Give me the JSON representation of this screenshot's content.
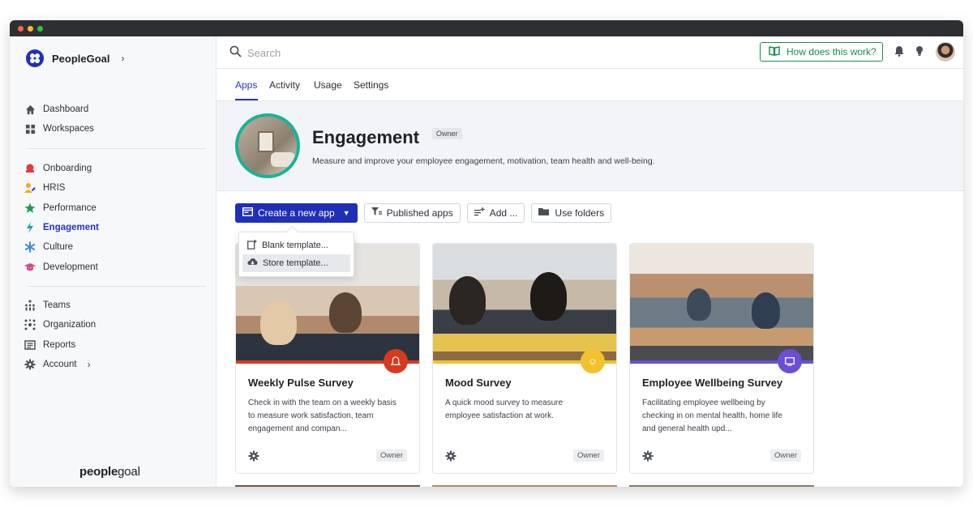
{
  "app": {
    "name": "PeopleGoal",
    "footer_brand_bold": "people",
    "footer_brand_light": "goal"
  },
  "sidebar": {
    "items_top": [
      {
        "label": "Dashboard",
        "icon": "home-icon"
      },
      {
        "label": "Workspaces",
        "icon": "grid-icon"
      }
    ],
    "items_modules": [
      {
        "label": "Onboarding",
        "icon": "onboarding-icon",
        "color": "#e23b3b"
      },
      {
        "label": "HRIS",
        "icon": "hris-icon",
        "color": "#f2a71b"
      },
      {
        "label": "Performance",
        "icon": "star-icon",
        "color": "#1f9d55"
      },
      {
        "label": "Engagement",
        "icon": "lightning-icon",
        "color": "#1aa39a"
      },
      {
        "label": "Culture",
        "icon": "asterisk-icon",
        "color": "#3a8de0"
      },
      {
        "label": "Development",
        "icon": "graduation-icon",
        "color": "#d9468c"
      }
    ],
    "items_bottom": [
      {
        "label": "Teams",
        "icon": "teams-icon"
      },
      {
        "label": "Organization",
        "icon": "organization-icon"
      },
      {
        "label": "Reports",
        "icon": "reports-icon"
      },
      {
        "label": "Account",
        "icon": "gear-icon"
      }
    ]
  },
  "topbar": {
    "search_placeholder": "Search",
    "help_label": "How does this work?"
  },
  "tabs": [
    "Apps",
    "Activity",
    "Usage",
    "Settings"
  ],
  "hero": {
    "title": "Engagement",
    "badge": "Owner",
    "description": "Measure and improve your employee engagement, motivation, team health and well-being."
  },
  "toolbar": {
    "create_label": "Create a new app",
    "published_label": "Published apps",
    "add_label": "Add ...",
    "folders_label": "Use folders"
  },
  "dropdown": {
    "items": [
      "Blank template...",
      "Store template..."
    ]
  },
  "cards": [
    {
      "title": "Weekly Pulse Survey",
      "description": "Check in with the team on a weekly basis to measure work satisfaction, team engagement and compan...",
      "badge": "Owner",
      "accent": "#d63a1f",
      "icon": "bell-icon"
    },
    {
      "title": "Mood Survey",
      "description": "A quick mood survey to measure employee satisfaction at work.",
      "badge": "Owner",
      "accent": "#f2c12e",
      "icon": "smiley-icon"
    },
    {
      "title": "Employee Wellbeing Survey",
      "description": "Facilitating employee wellbeing by checking in on mental health, home life and general health upd...",
      "badge": "Owner",
      "accent": "#6a4fd6",
      "icon": "monitor-icon"
    }
  ]
}
